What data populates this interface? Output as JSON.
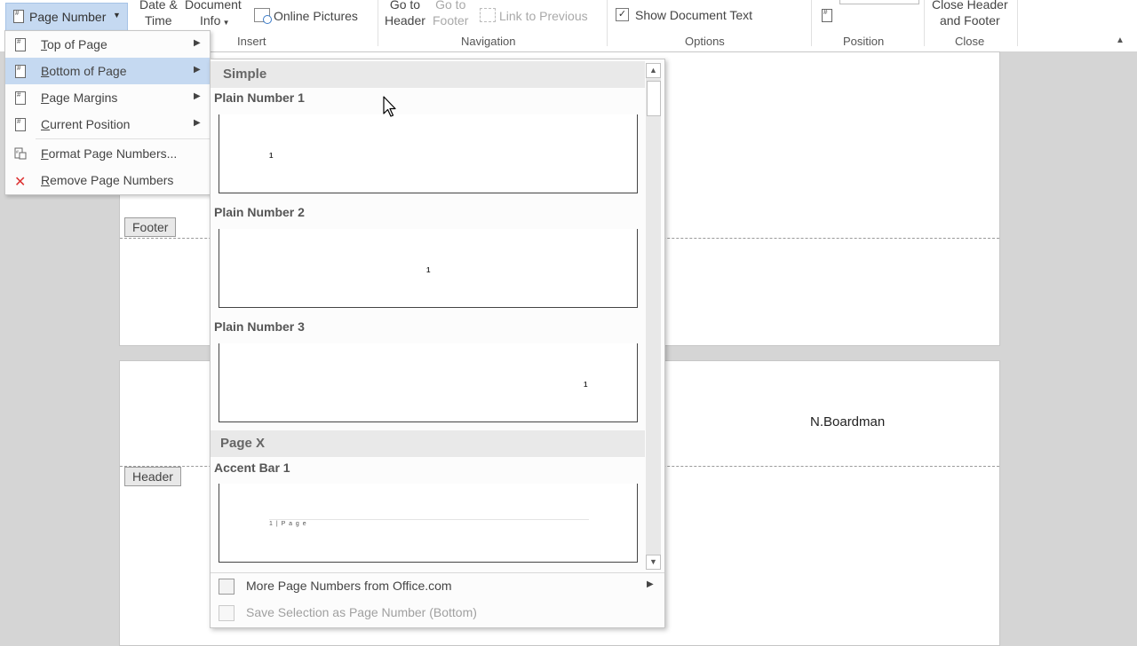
{
  "ribbon": {
    "page_number_label": "Page Number",
    "date_time_label": [
      "Date &",
      "Time"
    ],
    "document_info_label": [
      "Document",
      "Info"
    ],
    "online_pictures_label": "Online Pictures",
    "insert_group": "Insert",
    "go_to_header_label": [
      "Go to",
      "Header"
    ],
    "go_to_footer_label": [
      "Go to",
      "Footer"
    ],
    "link_to_previous_label": "Link to Previous",
    "navigation_group": "Navigation",
    "show_document_text_label": "Show Document Text",
    "options_group": "Options",
    "position_group": "Position",
    "close_header_footer_label": [
      "Close Header",
      "and Footer"
    ],
    "close_group": "Close"
  },
  "page_number_menu": {
    "items": [
      {
        "label": "Top of Page",
        "underline": "T",
        "submenu": true,
        "highlighted": false
      },
      {
        "label": "Bottom of Page",
        "underline": "B",
        "submenu": true,
        "highlighted": true
      },
      {
        "label": "Page Margins",
        "underline": "P",
        "submenu": true,
        "highlighted": false
      },
      {
        "label": "Current Position",
        "underline": "C",
        "submenu": true,
        "highlighted": false
      },
      {
        "label": "Format Page Numbers...",
        "underline": "F",
        "submenu": false,
        "highlighted": false
      },
      {
        "label": "Remove Page Numbers",
        "underline": "R",
        "submenu": false,
        "highlighted": false
      }
    ]
  },
  "gallery": {
    "sections": [
      {
        "title": "Simple"
      },
      {
        "title": "Page X"
      }
    ],
    "items": [
      {
        "title": "Plain Number 1",
        "preview": "1"
      },
      {
        "title": "Plain Number 2",
        "preview": "1"
      },
      {
        "title": "Plain Number 3",
        "preview": "1"
      },
      {
        "title": "Accent Bar 1",
        "preview": "1 | P a g e"
      }
    ],
    "more_label": "More Page Numbers from Office.com",
    "save_label": "Save Selection as Page Number (Bottom)"
  },
  "document": {
    "footer_tag": "Footer",
    "header_tag": "Header",
    "header_text": "N.Boardman"
  }
}
